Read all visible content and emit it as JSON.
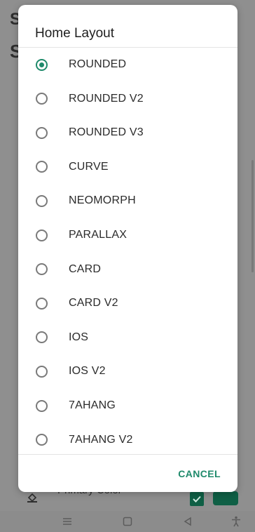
{
  "background": {
    "letter_top": "S",
    "letter_second": "S",
    "row_label": "Primary Color",
    "accent_color": "#0f5f45"
  },
  "dialog": {
    "title": "Home Layout",
    "selected_index": 0,
    "accent_color": "#1f8a6b",
    "options": [
      {
        "label": "ROUNDED",
        "checked": true
      },
      {
        "label": "ROUNDED V2",
        "checked": false
      },
      {
        "label": "ROUNDED V3",
        "checked": false
      },
      {
        "label": "CURVE",
        "checked": false
      },
      {
        "label": "NEOMORPH",
        "checked": false
      },
      {
        "label": "PARALLAX",
        "checked": false
      },
      {
        "label": "CARD",
        "checked": false
      },
      {
        "label": "CARD V2",
        "checked": false
      },
      {
        "label": "IOS",
        "checked": false
      },
      {
        "label": "IOS V2",
        "checked": false
      },
      {
        "label": "7AHANG",
        "checked": false
      },
      {
        "label": "7AHANG V2",
        "checked": false
      }
    ],
    "cancel_label": "CANCEL"
  },
  "navbar": {
    "icons": [
      "menu-icon",
      "home-square-icon",
      "back-triangle-icon",
      "accessibility-icon"
    ]
  }
}
